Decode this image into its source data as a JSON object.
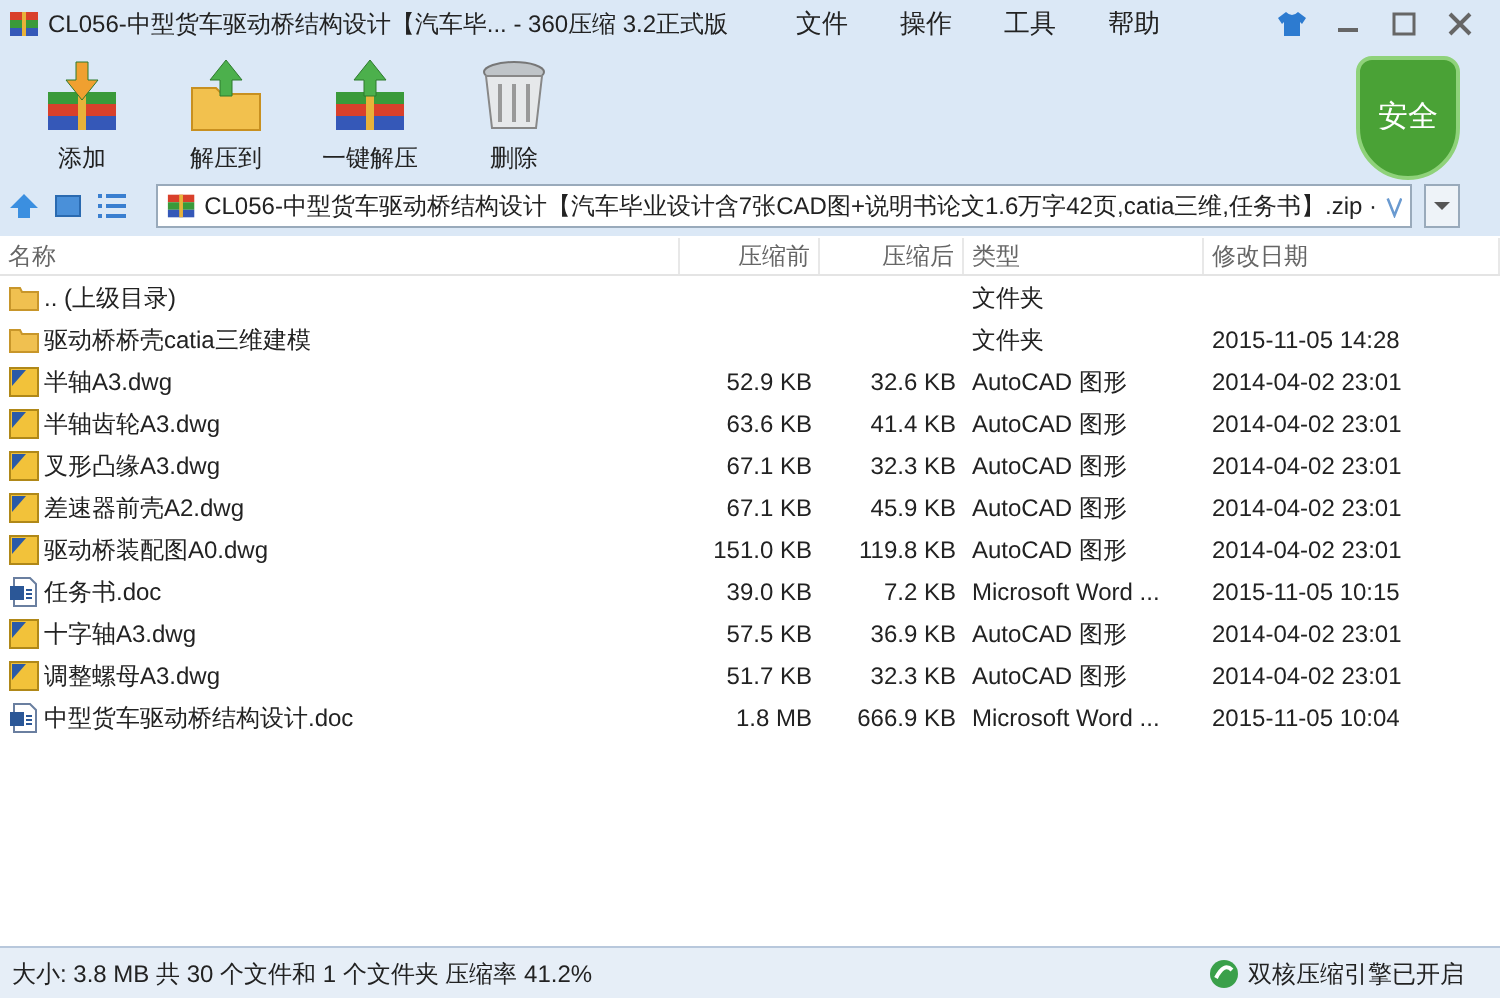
{
  "window": {
    "title": "CL056-中型货车驱动桥结构设计【汽车毕... - 360压缩 3.2正式版"
  },
  "menu": [
    "文件",
    "操作",
    "工具",
    "帮助"
  ],
  "toolbar": [
    {
      "kind": "add",
      "label": "添加"
    },
    {
      "kind": "extract",
      "label": "解压到"
    },
    {
      "kind": "oneclick",
      "label": "一键解压"
    },
    {
      "kind": "delete",
      "label": "删除"
    }
  ],
  "security_badge": "安全",
  "address": {
    "path": "CL056-中型货车驱动桥结构设计【汽车毕业设计含7张CAD图+说明书论文1.6万字42页,catia三维,任务书】.zip ·"
  },
  "table": {
    "columns": [
      "名称",
      "压缩前",
      "压缩后",
      "类型",
      "修改日期"
    ],
    "rows": [
      {
        "kind": "folder",
        "name": ".. (上级目录)",
        "size": "",
        "packed": "",
        "type": "文件夹",
        "modified": ""
      },
      {
        "kind": "folder",
        "name": "驱动桥桥壳catia三维建模",
        "size": "",
        "packed": "",
        "type": "文件夹",
        "modified": "2015-11-05 14:28"
      },
      {
        "kind": "dwg",
        "name": "半轴A3.dwg",
        "size": "52.9 KB",
        "packed": "32.6 KB",
        "type": "AutoCAD 图形",
        "modified": "2014-04-02 23:01"
      },
      {
        "kind": "dwg",
        "name": "半轴齿轮A3.dwg",
        "size": "63.6 KB",
        "packed": "41.4 KB",
        "type": "AutoCAD 图形",
        "modified": "2014-04-02 23:01"
      },
      {
        "kind": "dwg",
        "name": "叉形凸缘A3.dwg",
        "size": "67.1 KB",
        "packed": "32.3 KB",
        "type": "AutoCAD 图形",
        "modified": "2014-04-02 23:01"
      },
      {
        "kind": "dwg",
        "name": "差速器前壳A2.dwg",
        "size": "67.1 KB",
        "packed": "45.9 KB",
        "type": "AutoCAD 图形",
        "modified": "2014-04-02 23:01"
      },
      {
        "kind": "dwg",
        "name": "驱动桥装配图A0.dwg",
        "size": "151.0 KB",
        "packed": "119.8 KB",
        "type": "AutoCAD 图形",
        "modified": "2014-04-02 23:01"
      },
      {
        "kind": "doc",
        "name": "任务书.doc",
        "size": "39.0 KB",
        "packed": "7.2 KB",
        "type": "Microsoft Word ...",
        "modified": "2015-11-05 10:15"
      },
      {
        "kind": "dwg",
        "name": "十字轴A3.dwg",
        "size": "57.5 KB",
        "packed": "36.9 KB",
        "type": "AutoCAD 图形",
        "modified": "2014-04-02 23:01"
      },
      {
        "kind": "dwg",
        "name": "调整螺母A3.dwg",
        "size": "51.7 KB",
        "packed": "32.3 KB",
        "type": "AutoCAD 图形",
        "modified": "2014-04-02 23:01"
      },
      {
        "kind": "doc",
        "name": "中型货车驱动桥结构设计.doc",
        "size": "1.8 MB",
        "packed": "666.9 KB",
        "type": "Microsoft Word ...",
        "modified": "2015-11-05 10:04"
      }
    ]
  },
  "status_bar": {
    "summary": "大小: 3.8 MB 共 30 个文件和 1 个文件夹 压缩率 41.2%",
    "engine": "双核压缩引擎已开启"
  }
}
